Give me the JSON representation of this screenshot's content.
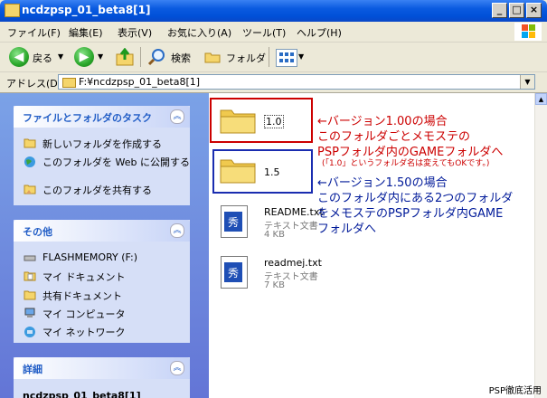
{
  "window": {
    "title": "ncdzpsp_01_beta8[1]",
    "colors": {
      "titlebar": "#0a5ae0",
      "left_pane": "#6f8ee0",
      "panel_head_text": "#215dc6"
    }
  },
  "menu": [
    "ファイル(F)",
    "編集(E)",
    "表示(V)",
    "お気に入り(A)",
    "ツール(T)",
    "ヘルプ(H)"
  ],
  "toolbar": {
    "back": "戻る",
    "search": "検索",
    "folders": "フォルダ"
  },
  "address": {
    "label": "アドレス(D)",
    "value": "F:¥ncdzpsp_01_beta8[1]"
  },
  "tasks_panel": {
    "title": "ファイルとフォルダのタスク",
    "items": [
      "新しいフォルダを作成する",
      "このフォルダを Web に公開する",
      "このフォルダを共有する"
    ]
  },
  "other_panel": {
    "title": "その他",
    "items": [
      "FLASHMEMORY (F:)",
      "マイ ドキュメント",
      "共有ドキュメント",
      "マイ コンピュータ",
      "マイ ネットワーク"
    ]
  },
  "details_panel": {
    "title": "詳細",
    "partial_text": "ncdzpsp_01_beta8[1]"
  },
  "files": [
    {
      "name": "1.0",
      "type": "folder"
    },
    {
      "name": "1.5",
      "type": "folder"
    },
    {
      "name": "README.txt",
      "kind": "テキスト文書",
      "size": "4 KB"
    },
    {
      "name": "readmej.txt",
      "kind": "テキスト文書",
      "size": "7 KB"
    }
  ],
  "annotations": {
    "red": {
      "color": "#cc0000",
      "line1": "←バージョン1.00の場合",
      "line2": "このフォルダごとメモステの",
      "line3": "PSPフォルダ内のGAMEフォルダへ",
      "note": "(「1.0」というフォルダ名は変えてもOKです。)"
    },
    "blue": {
      "color": "#001a99",
      "line1": "←バージョン1.50の場合",
      "line2": "このフォルダ内にある2つのフォルダ",
      "line3": "をメモステのPSPフォルダ内GAME",
      "line4": "フォルダへ"
    }
  },
  "watermark": "PSP徹底活用"
}
